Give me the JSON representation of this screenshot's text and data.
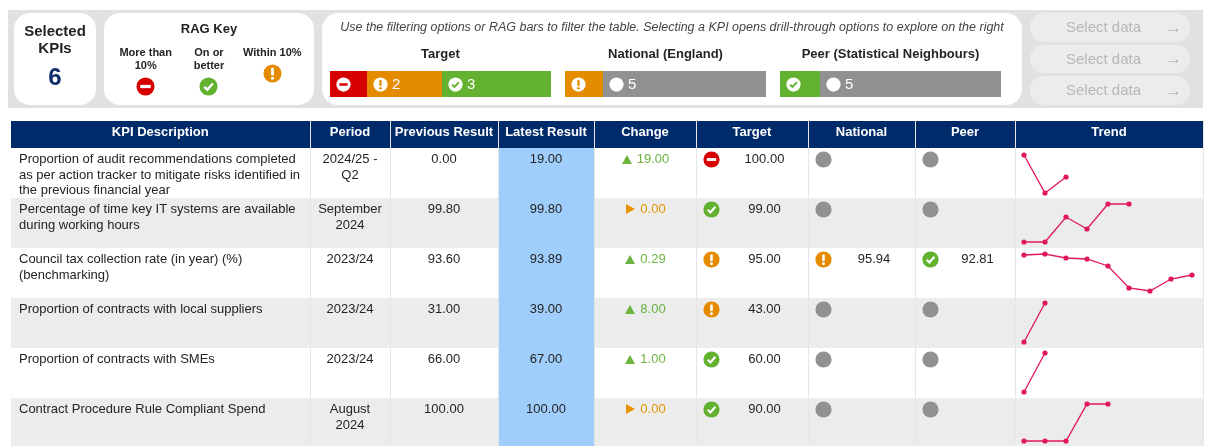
{
  "selected_kpis": {
    "label": "Selected KPIs",
    "count": "6"
  },
  "rag_key": {
    "title": "RAG Key",
    "items": [
      {
        "label": "More than 10%",
        "kind": "red"
      },
      {
        "label": "On or better",
        "kind": "green"
      },
      {
        "label": "Within 10%",
        "kind": "amber"
      }
    ]
  },
  "filter_panel": {
    "hint": "Use the filtering options or RAG bars to filter the table. Selecting a KPI opens drill-through options to explore on the right",
    "bars": [
      {
        "title": "Target",
        "segments": [
          {
            "kind": "red"
          },
          {
            "kind": "amber",
            "count": "2"
          },
          {
            "kind": "green",
            "count": "3"
          }
        ]
      },
      {
        "title": "National (England)",
        "segments": [
          {
            "kind": "amber"
          },
          {
            "kind": "none",
            "count": "5"
          }
        ]
      },
      {
        "title": "Peer (Statistical Neighbours)",
        "segments": [
          {
            "kind": "green"
          },
          {
            "kind": "none",
            "count": "5"
          }
        ]
      }
    ]
  },
  "side_buttons": [
    {
      "label": "Select data",
      "arrow": "→",
      "disabled": true
    },
    {
      "label": "Select data",
      "arrow": "→",
      "disabled": true
    },
    {
      "label": "Select data",
      "arrow": "→",
      "disabled": true
    }
  ],
  "table": {
    "columns": [
      "KPI Description",
      "Period",
      "Previous Result",
      "Latest Result",
      "Change",
      "Target",
      "National",
      "Peer",
      "Trend"
    ],
    "rows": [
      {
        "description": "Proportion of audit recommendations completed as per action tracker to mitigate risks identified in the previous financial year",
        "period": "2024/25 - Q2",
        "previous": "0.00",
        "latest": "19.00",
        "change": {
          "kind": "up",
          "text": "19.00"
        },
        "target": {
          "kind": "red",
          "value": "100.00"
        },
        "national": {
          "kind": "none"
        },
        "peer": {
          "kind": "none"
        }
      },
      {
        "description": "Percentage of time key IT systems are available during working hours",
        "period": "September 2024",
        "previous": "99.80",
        "latest": "99.80",
        "change": {
          "kind": "flat",
          "text": "0.00"
        },
        "target": {
          "kind": "green",
          "value": "99.00"
        },
        "national": {
          "kind": "none"
        },
        "peer": {
          "kind": "none"
        }
      },
      {
        "description": "Council tax collection rate (in year) (%) (benchmarking)",
        "period": "2023/24",
        "previous": "93.60",
        "latest": "93.89",
        "change": {
          "kind": "up",
          "text": "0.29"
        },
        "target": {
          "kind": "amber",
          "value": "95.00"
        },
        "national": {
          "kind": "amber",
          "value": "95.94"
        },
        "peer": {
          "kind": "green",
          "value": "92.81"
        }
      },
      {
        "description": "Proportion of contracts with local suppliers",
        "period": "2023/24",
        "previous": "31.00",
        "latest": "39.00",
        "change": {
          "kind": "up",
          "text": "8.00"
        },
        "target": {
          "kind": "amber",
          "value": "43.00"
        },
        "national": {
          "kind": "none"
        },
        "peer": {
          "kind": "none"
        }
      },
      {
        "description": "Proportion of contracts with SMEs",
        "period": "2023/24",
        "previous": "66.00",
        "latest": "67.00",
        "change": {
          "kind": "up",
          "text": "1.00"
        },
        "target": {
          "kind": "green",
          "value": "60.00"
        },
        "national": {
          "kind": "none"
        },
        "peer": {
          "kind": "none"
        }
      },
      {
        "description": "Contract Procedure Rule Compliant Spend",
        "period": "August 2024",
        "previous": "100.00",
        "latest": "100.00",
        "change": {
          "kind": "flat",
          "text": "0.00"
        },
        "target": {
          "kind": "green",
          "value": "90.00"
        },
        "national": {
          "kind": "none"
        },
        "peer": {
          "kind": "none"
        }
      }
    ]
  }
}
